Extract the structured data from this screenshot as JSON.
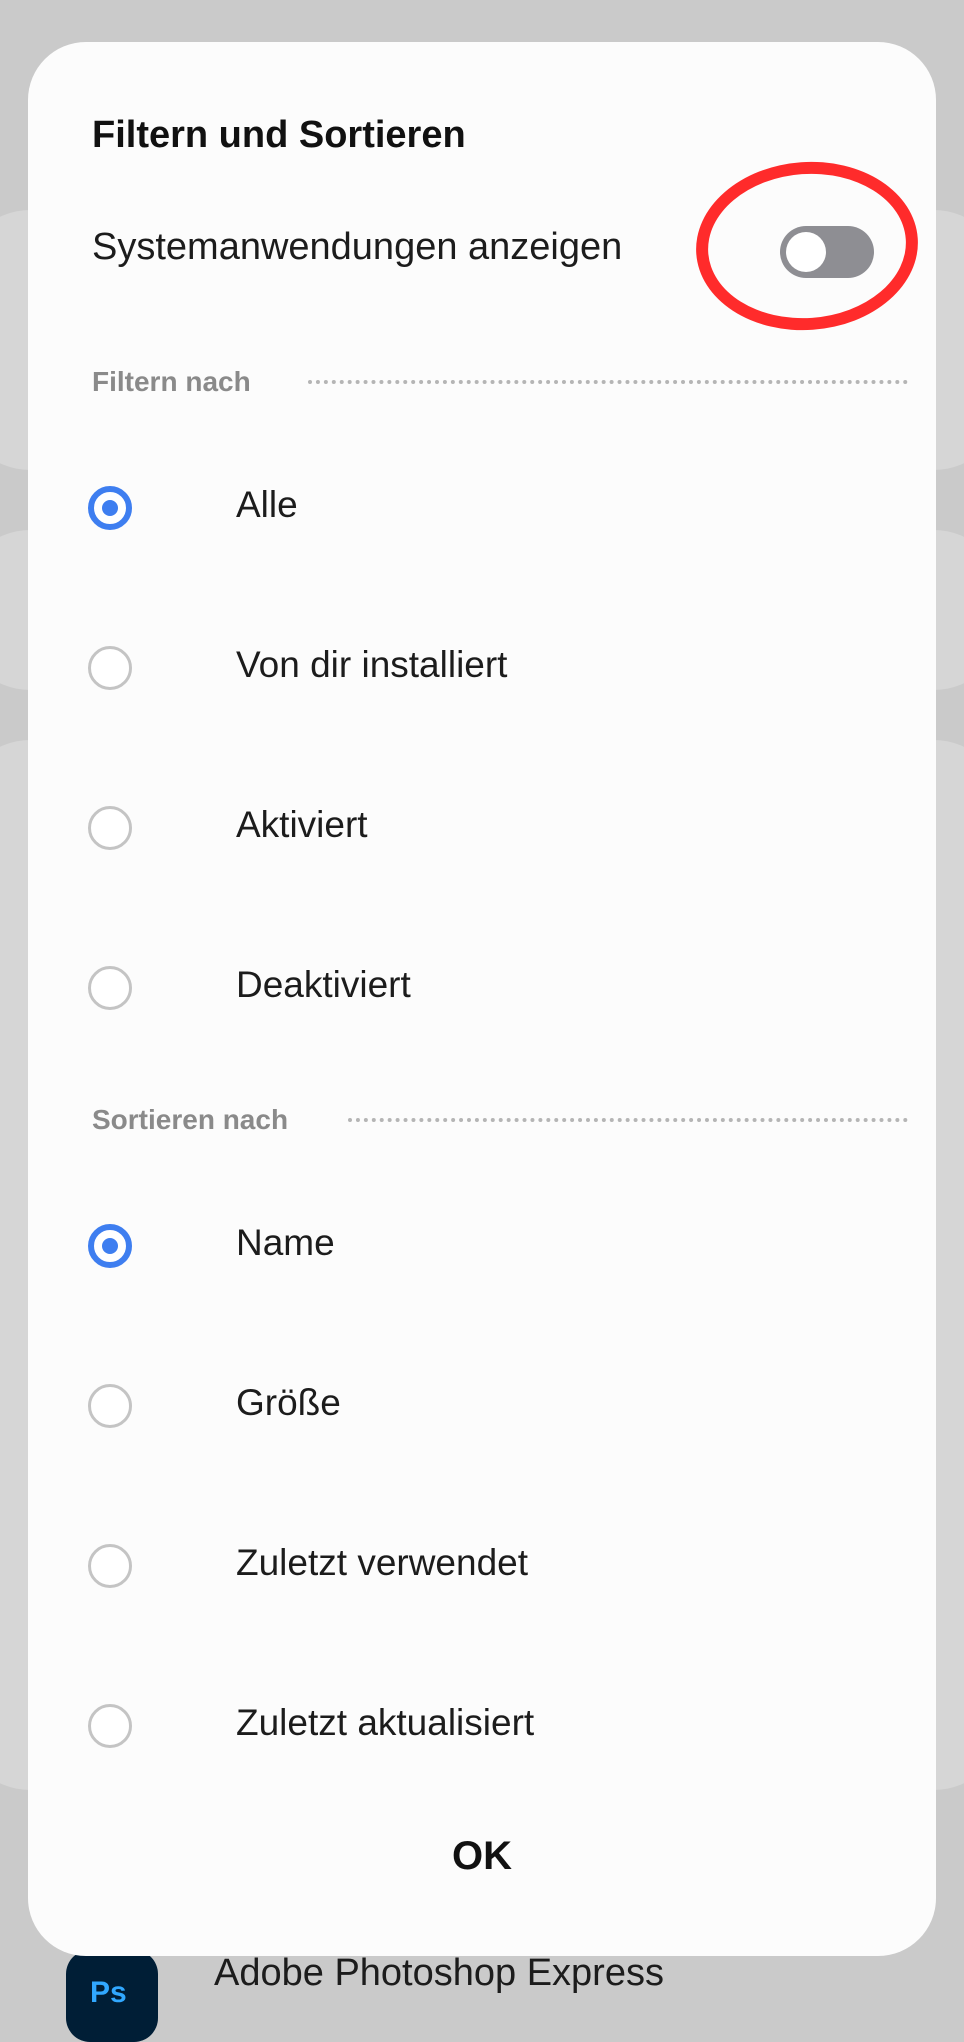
{
  "background": {
    "app_row": {
      "icon_text": "Ps",
      "label": "Adobe Photoshop Express"
    }
  },
  "dialog": {
    "title": "Filtern und Sortieren",
    "system_apps_toggle": {
      "label": "Systemanwendungen anzeigen",
      "state": "off"
    },
    "filter_section": {
      "label": "Filtern nach",
      "options": [
        {
          "label": "Alle",
          "selected": true
        },
        {
          "label": "Von dir installiert",
          "selected": false
        },
        {
          "label": "Aktiviert",
          "selected": false
        },
        {
          "label": "Deaktiviert",
          "selected": false
        }
      ]
    },
    "sort_section": {
      "label": "Sortieren nach",
      "options": [
        {
          "label": "Name",
          "selected": true
        },
        {
          "label": "Größe",
          "selected": false
        },
        {
          "label": "Zuletzt verwendet",
          "selected": false
        },
        {
          "label": "Zuletzt aktualisiert",
          "selected": false
        }
      ]
    },
    "ok_label": "OK"
  },
  "colors": {
    "accent": "#3e7ef0",
    "annotation_red": "#ff2b2b",
    "switch_off": "#8e8e93",
    "background_dim": "#cacaca"
  }
}
